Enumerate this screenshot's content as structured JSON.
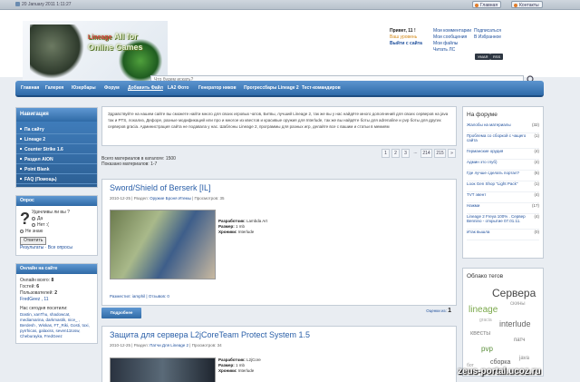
{
  "topbar": {
    "date": "20 January 2011 1:11:27",
    "btn_main": "Главная",
    "btn_contacts": "Контакты"
  },
  "header": {
    "logo_line1": "Lineage",
    "logo_line2": "All for Online Games",
    "user": {
      "greeting": "Привет, 11 !",
      "group": "Ваш уровень",
      "logout": "Выйти с сайта"
    },
    "links_col1": [
      "Мои комментарии",
      "Мои сообщения",
      "Мои файлы",
      "Читать ЛС"
    ],
    "links_col2": [
      "Подписаться",
      "В Избранное"
    ],
    "feed_btn1": "УМАЯ",
    "feed_btn2": "RSS",
    "search": {
      "placeholder": "Что будем искать?"
    }
  },
  "nav": {
    "items": [
      "Главная",
      "Галерея",
      "Юзербары",
      "Форум",
      "Добавить Файл",
      "LA2 Фото",
      "Генератор ников",
      "Прогрессбары Lineage 2",
      "Тест-командиров"
    ]
  },
  "left": {
    "nav_title": "Навигация",
    "menu": [
      "Па сайту",
      "Lineage 2",
      "Counter Strike 1.6",
      "Раздел AION",
      "Point Blank",
      "FAQ (Помощь)"
    ],
    "poll": {
      "title": "Опрос",
      "question": "Удачливы ли вы ?",
      "options": [
        "Да",
        "Нет :(",
        "Не знаю"
      ],
      "vote": "Ответить",
      "results": "Результаты · Все опросы"
    },
    "online": {
      "title": "Онлайн на сайте",
      "total_label": "Онлайн всего:",
      "total": "8",
      "guests_label": "Гостей:",
      "guests": "6",
      "users_label": "Пользователей:",
      "users": "2",
      "users_list": "FredGeez , 11",
      "today_label": "Нас сегодня посетили:",
      "today_list": "Dastin, xanThu, shadowcat, mediamarina, darkmastik, nice_ , Berdesh , Wiskas, FT_Riki, Gosti, toxi, pyrrhicas, galaxiss, seven11tosw, Cheburayka, FredGeez"
    }
  },
  "center": {
    "intro": "Здравствуйте на нашем сайте вы сможете найти много для своих игровых чатов, Битвы, лучший Lineage 2, так же вы у нас найдёте много дополнений для своих серверов на java так и PTS, локализ, Дефоре, разные модификаций или про и многое из квестов и красивые оружия для Interlude, так же вы найдёте боты для adrenaline и pvp боты для других серверов gracia. Администрация сайта не подавала у нас. Шаблоны Lineage 2, программы для разных игр, делайте все с вашим и статьи в мемиям",
    "totals_line1": "Всего материалов в каталоге: 1500",
    "totals_line2": "Показано материалов: 1-7",
    "pager": [
      "1",
      "2",
      "3",
      "...",
      "214",
      "215",
      "»"
    ],
    "post1": {
      "title": "Sword/Shield of Berserk [IL]",
      "date": "2010-12-25",
      "section_label": "Раздел:",
      "section": "Оружие Броня Итемы",
      "views": "Просмотров: 35",
      "dev_label": "Разработчик:",
      "dev": "Lambda Art",
      "size_label": "Размер:",
      "size": "1 mb",
      "chronicle_label": "Хроники:",
      "chronicle": "Interlude",
      "footer": "Разместил: iamphil | Отзывов: 0",
      "more": "Подробнее",
      "comments_label": "Оценки из:",
      "comments": "1"
    },
    "post2": {
      "title": "Защита для сервера L2jCoreTeam Protect System 1.5",
      "date": "2010-12-25",
      "section_label": "Раздел:",
      "section": "Патчи Для Lineage 2",
      "views": "Просмотров: 34",
      "dev_label": "Разработчик:",
      "dev": "L2jCore",
      "size_label": "Размер:",
      "size": "1 mb",
      "chronicle_label": "Хроники:",
      "chronicle": "Interlude"
    }
  },
  "right": {
    "forum_title": "На форуме",
    "forum_items": [
      {
        "t": "Жалобы на материалы",
        "c": "(32)"
      },
      {
        "t": "Проблема со сборкой с чащего сайта",
        "c": "(1)"
      },
      {
        "t": "Германские орудия",
        "c": "(4)"
      },
      {
        "t": "Админ это глуб)",
        "c": "(4)"
      },
      {
        "t": "Где лучше сделать портал?",
        "c": "(6)"
      },
      {
        "t": "Looк Gen Shop \"Light Pack\"",
        "c": "(1)"
      },
      {
        "t": "TVT эвент",
        "c": "(4)"
      },
      {
        "t": "Нажми",
        "c": "(17)"
      },
      {
        "t": "Lineage 2 Freya 100% . Сервер Bennino - открытие 07.01.11.",
        "c": "(4)"
      },
      {
        "t": "Итак вышла",
        "c": "(0)"
      }
    ],
    "tags_title": "Облако тегов",
    "tags": [
      "Сервера",
      "lineage",
      "interlude",
      "квесты",
      "скины",
      "pvp",
      "патч",
      "сборка",
      "бот",
      "java",
      "gracia"
    ]
  },
  "watermark": "zeus-portal.ucoz.ru"
}
